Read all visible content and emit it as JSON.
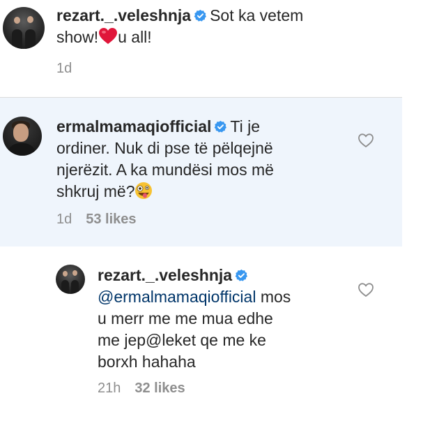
{
  "comments": [
    {
      "username": "rezart._.veleshnja",
      "text_before": "Sot ka vetem",
      "text_line2_before": "show!",
      "text_line2_after": "u all!",
      "emoji": "red-heart",
      "time": "1d",
      "likes": ""
    },
    {
      "username": "ermalmamaqiofficial",
      "text_line1": "Ti je",
      "text_line2": "ordiner. Nuk di pse të pëlqejnë",
      "text_line3": "njerëzit. A ka mundësi mos më",
      "text_line4": "shkruj më?",
      "emoji": "zany-face",
      "time": "1d",
      "likes": "53 likes",
      "highlighted": true
    },
    {
      "username": "rezart._.veleshnja",
      "mention": "@ermalmamaqiofficial",
      "text_line1_after": "mos",
      "text_line2": "u merr me me mua edhe",
      "text_line3": "me jep@leket qe me ke",
      "text_line4": "borxh hahaha",
      "time": "21h",
      "likes": "32 likes"
    }
  ],
  "colors": {
    "highlight_bg": "#eff5fc",
    "verified_blue": "#3897f0",
    "meta_gray": "#8e8e8e",
    "divider": "#dbdbdb"
  }
}
